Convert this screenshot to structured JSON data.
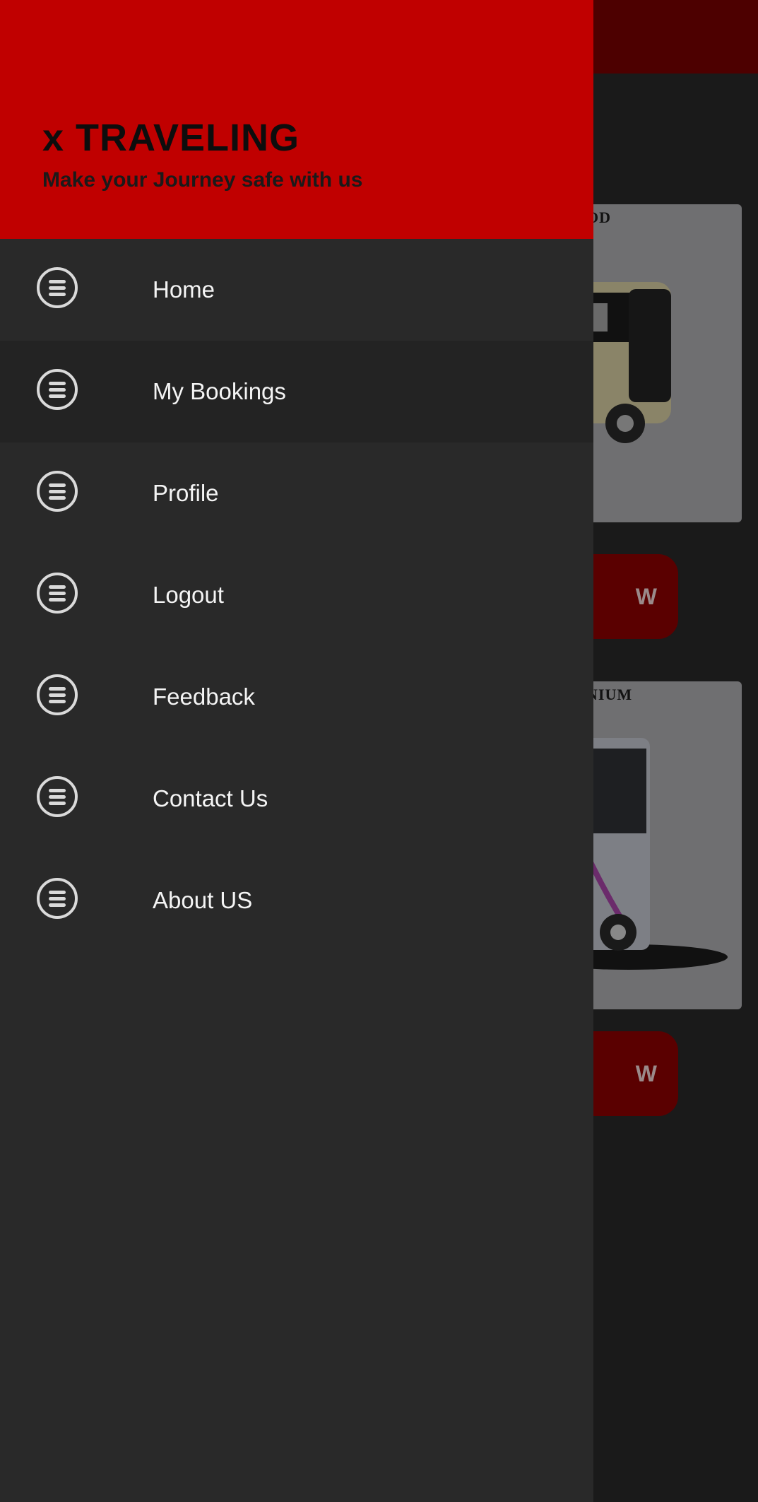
{
  "app": {
    "title": "x TRAVELING",
    "subtitle": "Make your Journey safe with us"
  },
  "menu": {
    "items": [
      {
        "label": "Home",
        "icon": "menu-circle-icon"
      },
      {
        "label": "My Bookings",
        "icon": "menu-circle-icon",
        "selected": true
      },
      {
        "label": "Profile",
        "icon": "menu-circle-icon"
      },
      {
        "label": "Logout",
        "icon": "menu-circle-icon"
      },
      {
        "label": "Feedback",
        "icon": "menu-circle-icon"
      },
      {
        "label": "Contact Us",
        "icon": "menu-circle-icon"
      },
      {
        "label": "About US",
        "icon": "menu-circle-icon"
      }
    ]
  },
  "background": {
    "cards": [
      {
        "title_fragment": "OD",
        "button_fragment": "W"
      },
      {
        "title_fragment": "NIUM",
        "button_fragment": "W"
      }
    ]
  },
  "colors": {
    "header": "#c00000",
    "drawer": "#292929",
    "selected_item": "#232323",
    "toolbar_dimmed": "#4d0000"
  }
}
